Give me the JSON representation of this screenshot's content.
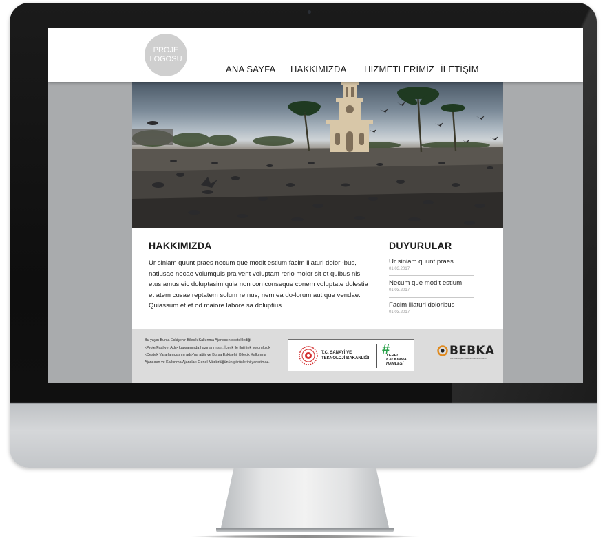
{
  "header": {
    "logo_line1": "PROJE",
    "logo_line2": "LOGOSU",
    "nav": [
      "ANA SAYFA",
      "HAKKIMIZDA",
      "HİZMETLERİMİZ",
      "İLETİŞİM"
    ]
  },
  "about": {
    "title": "HAKKIMIZDA",
    "text": "Ur siniam quunt praes necum que modit estium facim iliaturi dolori-bus, natiusae necae volumquis pra vent voluptam rerio molor sit et quibus nis etus amus eic doluptasim quia non con conseque conem voluptate dolestia et atem cusae reptatem solum re nus, nem ea do-lorum aut que vendae. Quiassum et et od maiore labore sa doluptius."
  },
  "announcements": {
    "title": "DUYURULAR",
    "items": [
      {
        "title": "Ur siniam quunt praes",
        "date": "01.03.2017"
      },
      {
        "title": "Necum que modit estium",
        "date": "01.03.2017"
      },
      {
        "title": "Facim iliaturi doloribus",
        "date": "01.03.2017"
      }
    ]
  },
  "footer": {
    "disclaimer": "Bu yayın Bursa Eskişehir Bilecik Kalkınma Ajansının desteklediği <Proje/Faaliyet Adı> kapsamında hazırlanmıştır. İçerik ile ilgili tek sorumluluk <Destek Yararlanıcısının adı>'na aittir ve Bursa Eskişehir Bilecik Kalkınma Ajansının ve Kalkınma Ajansları Genel Müdürlüğünün görüşlerini yansıtmaz.",
    "ministry_line1": "T.C. SANAYİ VE",
    "ministry_line2": "TEKNOLOJİ BAKANLIĞI",
    "hashtag": "#",
    "hashtag_line1": "YEREL",
    "hashtag_line2": "KALKINMA",
    "hashtag_line3": "HAMLESİ",
    "bebka_name": "BEBKA",
    "bebka_sub": "Bursa Eskişehir Bilecik Kalkınma Ajansı"
  },
  "colors": {
    "page_bg": "#a9abad",
    "content_bg": "#ffffff",
    "footer_bg": "#dcdcdc",
    "hashtag_green": "#2aa14a",
    "ministry_red": "#d32f2f"
  }
}
